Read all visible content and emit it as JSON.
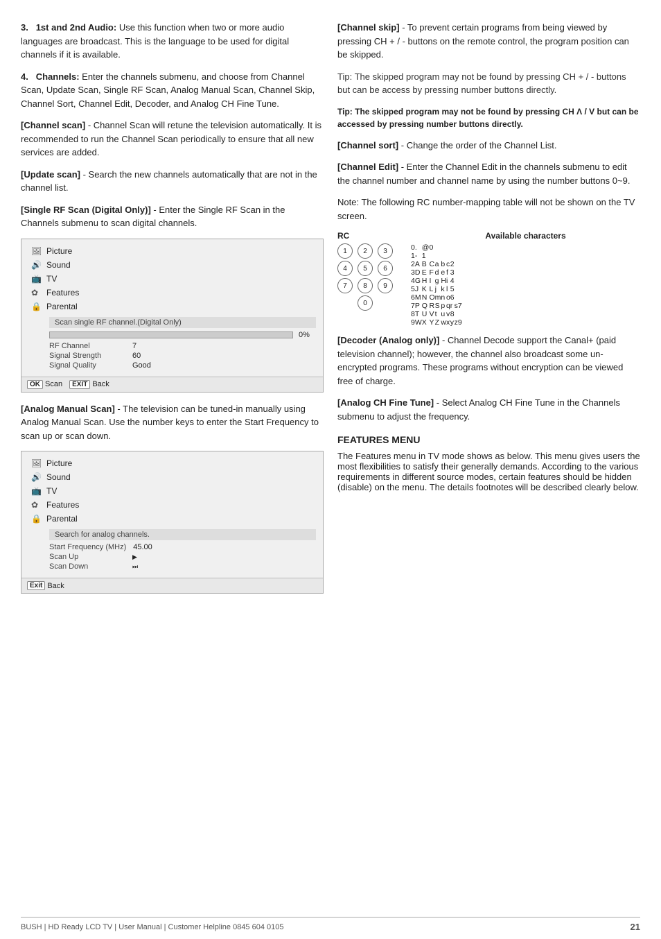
{
  "page": {
    "footer": {
      "brand": "BUSH | HD Ready LCD TV | User Manual | Customer Helpline 0845 604 0105",
      "page_number": "21"
    }
  },
  "left_col": {
    "item3": {
      "number": "3.",
      "label": "1st and 2nd Audio:",
      "text": "Use this function when two or more audio languages are broadcast. This is the language to be used for digital channels if it is available."
    },
    "item4": {
      "number": "4.",
      "label": "Channels:",
      "text": "Enter the channels submenu, and choose from Channel Scan, Update Scan, Single RF Scan, Analog Manual Scan, Channel Skip, Channel Sort, Channel Edit, Decoder, and Analog CH Fine Tune."
    },
    "channel_scan": {
      "label": "[Channel scan]",
      "text": "- Channel Scan will retune the television automatically. It is recommended to run the Channel Scan periodically to ensure that all new services are added."
    },
    "update_scan": {
      "label": "[Update scan]",
      "text": "- Search the new channels automatically that are not in the channel list."
    },
    "single_rf": {
      "label": "[Single RF Scan (Digital Only)]",
      "text": "- Enter the Single RF Scan in the Channels submenu to scan digital channels."
    },
    "menu1": {
      "items": [
        {
          "icon": "picture",
          "label": "Picture",
          "active": false
        },
        {
          "icon": "sound",
          "label": "Sound",
          "active": false
        },
        {
          "icon": "tv",
          "label": "TV",
          "active": false
        },
        {
          "icon": "features",
          "label": "Features",
          "active": false
        },
        {
          "icon": "parental",
          "label": "Parental",
          "active": false
        }
      ],
      "scan_label": "Scan single RF channel.(Digital Only)",
      "progress_pct": "0%",
      "details": [
        {
          "key": "RF Channel",
          "value": "7"
        },
        {
          "key": "Signal Strength",
          "value": "60"
        },
        {
          "key": "Signal Quality",
          "value": "Good"
        }
      ],
      "footer": [
        {
          "btn": "OK",
          "label": "Scan"
        },
        {
          "btn": "EXIT",
          "label": "Back"
        }
      ]
    },
    "analog_manual_scan": {
      "label": "[Analog Manual Scan]",
      "text": "- The television can be tuned-in manually using Analog Manual Scan. Use the number keys to enter the Start Frequency to scan up or scan down."
    },
    "menu2": {
      "items": [
        {
          "icon": "picture",
          "label": "Picture",
          "active": false
        },
        {
          "icon": "sound",
          "label": "Sound",
          "active": false
        },
        {
          "icon": "tv",
          "label": "TV",
          "active": false
        },
        {
          "icon": "features",
          "label": "Features",
          "active": false
        },
        {
          "icon": "parental",
          "label": "Parental",
          "active": false
        }
      ],
      "scan_label": "Search for analog channels.",
      "details": [
        {
          "key": "Start Frequency (MHz)",
          "value": "45.00"
        },
        {
          "key": "Scan Up",
          "value": ""
        },
        {
          "key": "Scan Down",
          "value": ""
        }
      ],
      "footer": [
        {
          "btn": "Exit",
          "label": "Back"
        }
      ]
    }
  },
  "right_col": {
    "channel_skip": {
      "label": "[Channel skip]",
      "text": "- To prevent certain programs from being viewed by pressing CH + / - buttons on the remote control, the program position can be skipped."
    },
    "tip1": {
      "text": "Tip: The skipped program may not be found by pressing CH + / - buttons but can be access by pressing number buttons directly."
    },
    "tip2_bold": {
      "text": "Tip: The skipped program may not be found by pressing CH Λ / V but can be accessed by pressing number buttons directly."
    },
    "channel_sort": {
      "label": "[Channel sort]",
      "text": "- Change the order of the Channel List."
    },
    "channel_edit": {
      "label": "[Channel Edit]",
      "text": "- Enter the Channel Edit in the channels submenu to edit the channel number and channel name by using the number buttons 0~9."
    },
    "note": {
      "text": "Note: The following RC number-mapping table will not be shown on the TV screen."
    },
    "rc_table": {
      "header_rc": "RC",
      "header_available": "Available characters",
      "keys": [
        [
          "1",
          "2",
          "3"
        ],
        [
          "4",
          "5",
          "6"
        ],
        [
          "7",
          "8",
          "9"
        ],
        [
          "",
          "0",
          ""
        ]
      ],
      "chars": [
        {
          "num": "0",
          "chars": [
            ". @ 0"
          ]
        },
        {
          "num": "1",
          "chars": [
            "- 1"
          ]
        },
        {
          "num": "2",
          "chars": [
            "A B C a b c 2"
          ]
        },
        {
          "num": "3",
          "chars": [
            "D E F d e f 3"
          ]
        },
        {
          "num": "4",
          "chars": [
            "G H I g H i 4"
          ]
        },
        {
          "num": "5",
          "chars": [
            "J K L j k l 5"
          ]
        },
        {
          "num": "6",
          "chars": [
            "M N O m n o 6"
          ]
        },
        {
          "num": "7",
          "chars": [
            "P Q R S p q r s 7"
          ]
        },
        {
          "num": "8",
          "chars": [
            "T U V t u v 8"
          ]
        },
        {
          "num": "9",
          "chars": [
            "W X Y Z w x y z 9"
          ]
        }
      ]
    },
    "decoder": {
      "label": "[Decoder (Analog only)]",
      "text": "- Channel Decode support the Canal+ (paid television channel); however, the channel also broadcast some un-encrypted programs. These programs without encryption can be viewed free of charge."
    },
    "analog_fine_tune": {
      "label": "[Analog CH Fine Tune]",
      "text": "- Select Analog CH Fine Tune in the Channels submenu to adjust the frequency."
    },
    "features_menu": {
      "heading": "FEATURES MENU",
      "text": "The Features menu in TV mode shows as below. This menu gives users the most flexibilities to satisfy their generally demands. According to the various requirements in different source modes, certain features should be hidden (disable) on the menu. The details footnotes will be described clearly below."
    }
  }
}
